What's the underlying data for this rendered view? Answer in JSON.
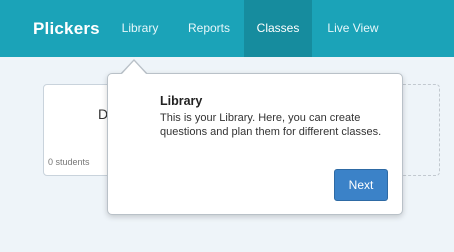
{
  "navbar": {
    "brand": "Plickers",
    "items": [
      {
        "label": "Library",
        "active": false
      },
      {
        "label": "Reports",
        "active": false
      },
      {
        "label": "Classes",
        "active": true
      },
      {
        "label": "Live View",
        "active": false
      }
    ],
    "color": "#1ba3b8",
    "active_color": "#168c9e"
  },
  "class_card": {
    "title_partial": "D",
    "students": "0 students"
  },
  "popover": {
    "title": "Library",
    "text": "This is your Library. Here, you can create questions and plan them for different classes.",
    "next_label": "Next",
    "button_color": "#3b82c8"
  }
}
